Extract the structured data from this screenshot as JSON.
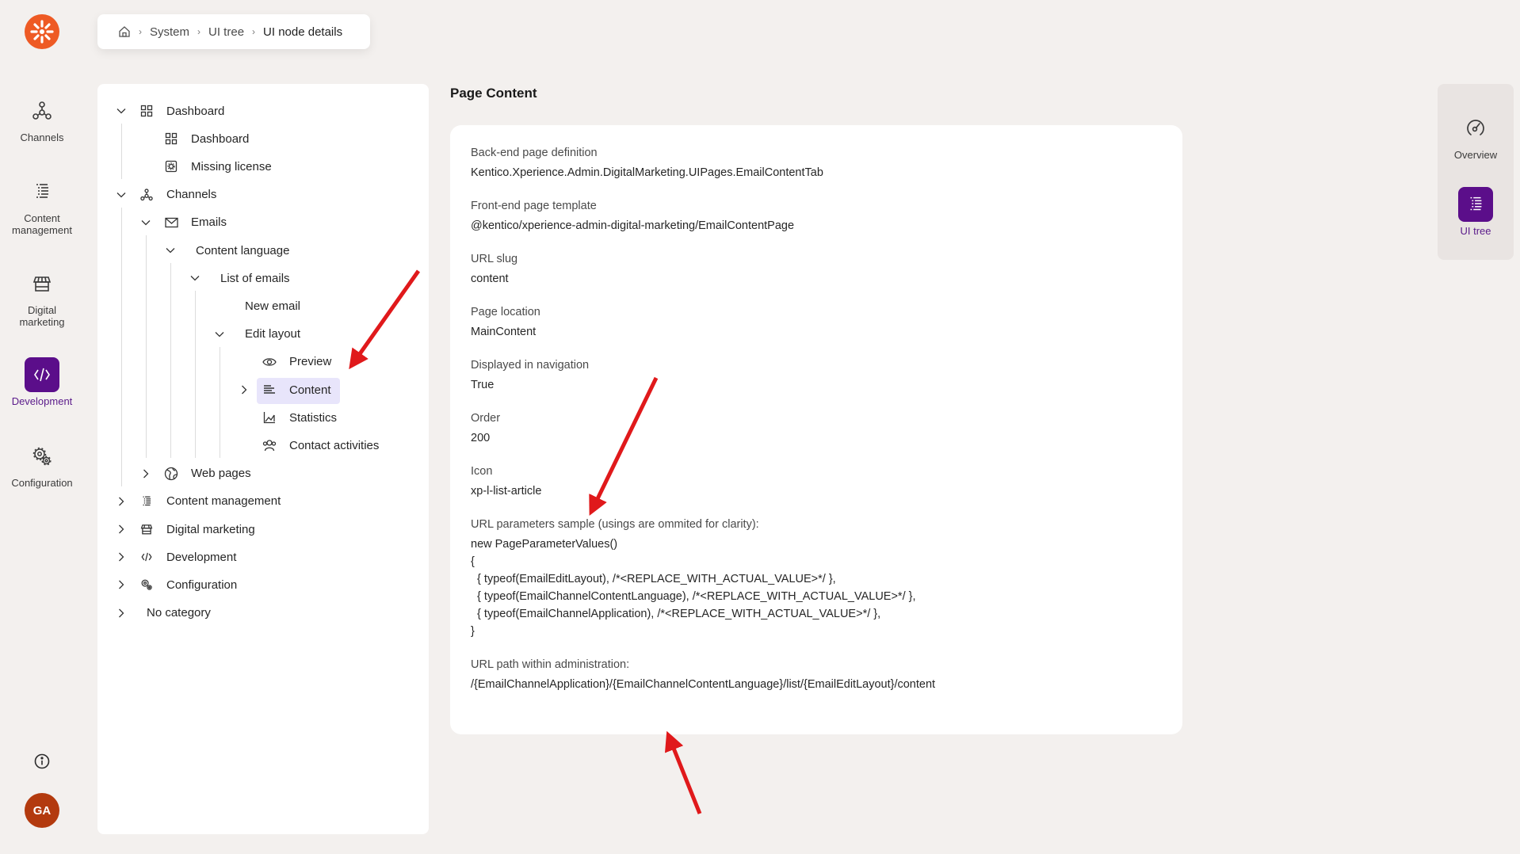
{
  "logo": {
    "icon": "kentico-logo-icon",
    "color": "#ee5a24"
  },
  "leftnav": {
    "items": [
      {
        "label": "Channels",
        "icon": "channels-icon",
        "active": false
      },
      {
        "label": "Content management",
        "label_line1": "Content",
        "label_line2": "management",
        "icon": "content-management-icon",
        "active": false
      },
      {
        "label": "Digital marketing",
        "label_line1": "Digital",
        "label_line2": "marketing",
        "icon": "digital-marketing-icon",
        "active": false
      },
      {
        "label": "Development",
        "icon": "code-icon",
        "active": true
      },
      {
        "label": "Configuration",
        "icon": "gears-icon",
        "active": false
      }
    ],
    "info_icon": "info-icon",
    "avatar_initials": "GA",
    "active_color": "#5b0e8a"
  },
  "breadcrumb": {
    "home_icon": "home-icon",
    "items": [
      "System",
      "UI tree",
      "UI node details"
    ],
    "separator": "›"
  },
  "tree": {
    "nodes": [
      {
        "label": "Dashboard",
        "level": 0,
        "expander": "expanded",
        "icon": "dashboard-icon"
      },
      {
        "label": "Dashboard",
        "level": 1,
        "expander": "none",
        "icon": "dashboard-icon"
      },
      {
        "label": "Missing license",
        "level": 1,
        "expander": "none",
        "icon": "license-icon"
      },
      {
        "label": "Channels",
        "level": 0,
        "expander": "expanded",
        "icon": "channels-icon"
      },
      {
        "label": "Emails",
        "level": 1,
        "expander": "expanded",
        "icon": "email-icon"
      },
      {
        "label": "Content language",
        "level": 2,
        "expander": "expanded",
        "icon": ""
      },
      {
        "label": "List of emails",
        "level": 3,
        "expander": "expanded",
        "icon": ""
      },
      {
        "label": "New email",
        "level": 4,
        "expander": "none",
        "icon": ""
      },
      {
        "label": "Edit layout",
        "level": 4,
        "expander": "expanded",
        "icon": ""
      },
      {
        "label": "Preview",
        "level": 5,
        "expander": "none",
        "icon": "eye-icon"
      },
      {
        "label": "Content",
        "level": 5,
        "expander": "collapsed",
        "icon": "list-article-icon",
        "selected": true
      },
      {
        "label": "Statistics",
        "level": 5,
        "expander": "none",
        "icon": "chart-icon"
      },
      {
        "label": "Contact activities",
        "level": 5,
        "expander": "none",
        "icon": "contacts-icon"
      },
      {
        "label": "Web pages",
        "level": 1,
        "expander": "collapsed",
        "icon": "globe-icon"
      },
      {
        "label": "Content management",
        "level": 0,
        "expander": "collapsed",
        "icon": "content-management-icon"
      },
      {
        "label": "Digital marketing",
        "level": 0,
        "expander": "collapsed",
        "icon": "digital-marketing-icon"
      },
      {
        "label": "Development",
        "level": 0,
        "expander": "collapsed",
        "icon": "code-icon"
      },
      {
        "label": "Configuration",
        "level": 0,
        "expander": "collapsed",
        "icon": "gears-icon"
      },
      {
        "label": "No category",
        "level": 0,
        "expander": "collapsed",
        "icon": ""
      }
    ],
    "selected_bg": "#e8e5fb"
  },
  "main": {
    "title": "Page Content",
    "fields": [
      {
        "label": "Back-end page definition",
        "value": "Kentico.Xperience.Admin.DigitalMarketing.UIPages.EmailContentTab"
      },
      {
        "label": "Front-end page template",
        "value": "@kentico/xperience-admin-digital-marketing/EmailContentPage"
      },
      {
        "label": "URL slug",
        "value": "content"
      },
      {
        "label": "Page location",
        "value": "MainContent"
      },
      {
        "label": "Displayed in navigation",
        "value": "True"
      },
      {
        "label": "Order",
        "value": "200"
      },
      {
        "label": "Icon",
        "value": "xp-l-list-article"
      }
    ],
    "url_params": {
      "label": "URL parameters sample (usings are ommited for clarity):",
      "lines": [
        "new PageParameterValues()",
        "{",
        "  { typeof(EmailEditLayout), /*<REPLACE_WITH_ACTUAL_VALUE>*/ },",
        "  { typeof(EmailChannelContentLanguage), /*<REPLACE_WITH_ACTUAL_VALUE>*/ },",
        "  { typeof(EmailChannelApplication), /*<REPLACE_WITH_ACTUAL_VALUE>*/ },",
        "}"
      ]
    },
    "url_path": {
      "label": "URL path within administration:",
      "value": "/{EmailChannelApplication}/{EmailChannelContentLanguage}/list/{EmailEditLayout}/content"
    }
  },
  "right_panel": {
    "items": [
      {
        "label": "Overview",
        "icon": "gauge-icon",
        "active": false
      },
      {
        "label": "UI tree",
        "icon": "ui-tree-icon",
        "active": true
      }
    ]
  },
  "annotations": {
    "arrow_color": "#e0191b",
    "count": 3
  }
}
